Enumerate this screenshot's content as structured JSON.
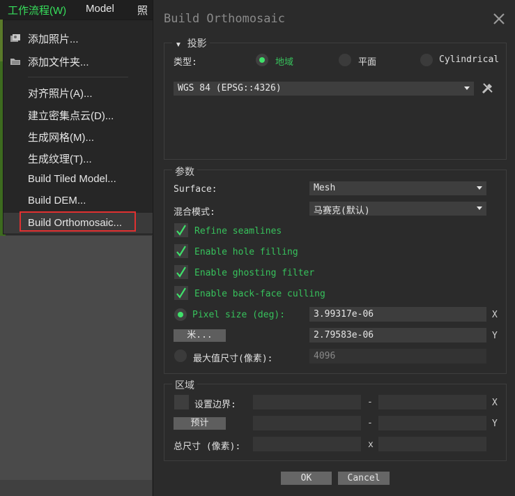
{
  "menubar": {
    "items": [
      {
        "label": "工作流程(W)",
        "active": true
      },
      {
        "label": "Model"
      },
      {
        "label": "照片"
      }
    ]
  },
  "workflow_menu": {
    "items": [
      {
        "label": "添加照片...",
        "icon": "add-photo-icon"
      },
      {
        "label": "添加文件夹...",
        "icon": "add-folder-icon"
      },
      {
        "label": "对齐照片(A)..."
      },
      {
        "label": "建立密集点云(D)..."
      },
      {
        "label": "生成网格(M)..."
      },
      {
        "label": "生成纹理(T)..."
      },
      {
        "label": "Build Tiled Model..."
      },
      {
        "label": "Build DEM..."
      },
      {
        "label": "Build Orthomosaic...",
        "highlighted": true
      }
    ]
  },
  "dialog": {
    "title": "Build Orthomosaic",
    "projection": {
      "legend": "投影",
      "type_label": "类型:",
      "types": [
        "地域",
        "平面",
        "Cylindrical"
      ],
      "selected_type": "地域",
      "crs_value": "WGS 84 (EPSG::4326)"
    },
    "params": {
      "legend": "参数",
      "surface_label": "Surface:",
      "surface_value": "Mesh",
      "blend_label": "混合模式:",
      "blend_value": "马赛克(默认)",
      "checks": [
        {
          "label": "Refine seamlines",
          "checked": true
        },
        {
          "label": "Enable hole filling",
          "checked": true
        },
        {
          "label": "Enable ghosting filter",
          "checked": true
        },
        {
          "label": "Enable back-face culling",
          "checked": true
        }
      ],
      "pixel_size_label": "Pixel size (deg):",
      "pixel_x": "3.99317e-06",
      "pixel_y": "2.79583e-06",
      "meters_button": "米...",
      "max_size_label": "最大值尺寸(像素):",
      "max_size_value": "4096",
      "x_label": "X",
      "y_label": "Y"
    },
    "region": {
      "legend": "区域",
      "boundary_label": "设置边界:",
      "estimate_button": "预计",
      "total_label": "总尺寸 (像素):",
      "dash": "-",
      "times": "x",
      "x_label": "X",
      "y_label": "Y"
    },
    "ok_button": "OK",
    "cancel_button": "Cancel"
  },
  "colors": {
    "accent_green": "#37c25c",
    "highlight_border": "#e03030"
  }
}
